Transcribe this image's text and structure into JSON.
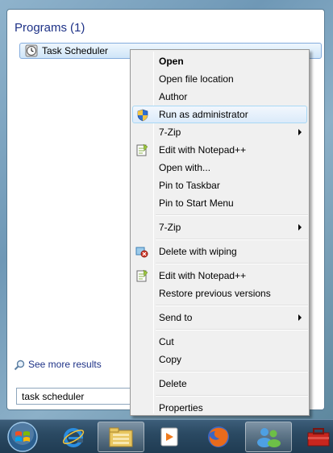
{
  "programs": {
    "header": "Programs",
    "count": "(1)",
    "result": "Task Scheduler"
  },
  "see_more": "See more results",
  "search": {
    "value": "task scheduler"
  },
  "context_menu": {
    "open": "Open",
    "open_file_location": "Open file location",
    "author": "Author",
    "run_as_admin": "Run as administrator",
    "seven_zip_1": "7-Zip",
    "edit_notepad_1": "Edit with Notepad++",
    "open_with": "Open with...",
    "pin_taskbar": "Pin to Taskbar",
    "pin_start": "Pin to Start Menu",
    "seven_zip_2": "7-Zip",
    "delete_wiping": "Delete with wiping",
    "edit_notepad_2": "Edit with Notepad++",
    "restore_versions": "Restore previous versions",
    "send_to": "Send to",
    "cut": "Cut",
    "copy": "Copy",
    "delete": "Delete",
    "properties": "Properties"
  },
  "taskbar": {
    "icons": [
      "windows-start-orb",
      "internet-explorer-icon",
      "file-explorer-icon",
      "media-player-icon",
      "firefox-icon",
      "people-icon",
      "toolbox-icon"
    ]
  },
  "colors": {
    "header_blue": "#1e3287",
    "hover_border": "#a8d8f5",
    "taskbar": "#2b4a63"
  }
}
